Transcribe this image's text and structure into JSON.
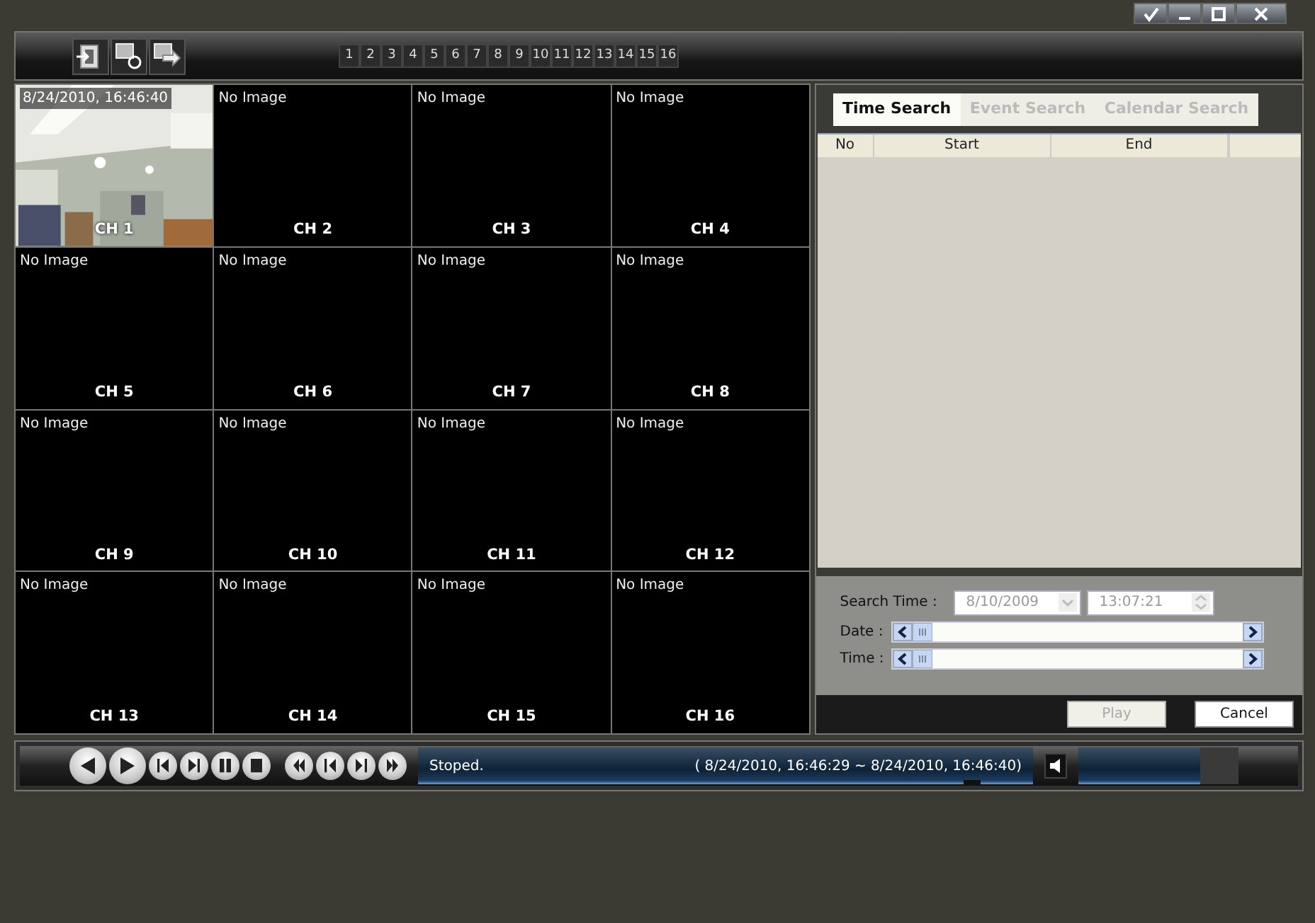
{
  "channel_buttons": [
    "1",
    "2",
    "3",
    "4",
    "5",
    "6",
    "7",
    "8",
    "9",
    "10",
    "11",
    "12",
    "13",
    "14",
    "15",
    "16"
  ],
  "channels": [
    {
      "kind": "picture",
      "timestamp": "8/24/2010, 16:46:40",
      "label": "CH 1"
    },
    {
      "kind": "empty",
      "status": "No Image",
      "label": "CH 2"
    },
    {
      "kind": "empty",
      "status": "No Image",
      "label": "CH 3"
    },
    {
      "kind": "empty",
      "status": "No Image",
      "label": "CH 4"
    },
    {
      "kind": "empty",
      "status": "No Image",
      "label": "CH 5"
    },
    {
      "kind": "empty",
      "status": "No Image",
      "label": "CH 6"
    },
    {
      "kind": "empty",
      "status": "No Image",
      "label": "CH 7"
    },
    {
      "kind": "empty",
      "status": "No Image",
      "label": "CH 8"
    },
    {
      "kind": "empty",
      "status": "No Image",
      "label": "CH 9"
    },
    {
      "kind": "empty",
      "status": "No Image",
      "label": "CH 10"
    },
    {
      "kind": "empty",
      "status": "No Image",
      "label": "CH 11"
    },
    {
      "kind": "empty",
      "status": "No Image",
      "label": "CH 12"
    },
    {
      "kind": "empty",
      "status": "No Image",
      "label": "CH 13"
    },
    {
      "kind": "empty",
      "status": "No Image",
      "label": "CH 14"
    },
    {
      "kind": "empty",
      "status": "No Image",
      "label": "CH 15"
    },
    {
      "kind": "empty",
      "status": "No Image",
      "label": "CH 16"
    }
  ],
  "search_tabs": [
    {
      "label": "Time Search",
      "selected": true
    },
    {
      "label": "Event Search",
      "selected": false
    },
    {
      "label": "Calendar Search",
      "selected": false
    }
  ],
  "table": {
    "columns": [
      "No",
      "Start",
      "End"
    ]
  },
  "search_form": {
    "search_time_label": "Search Time :",
    "date_value": "8/10/2009",
    "time_value": "13:07:21",
    "disabled": true,
    "date_label": "Date :",
    "time_label": "Time :"
  },
  "buttons": [
    {
      "label": "Play",
      "disabled": true
    },
    {
      "label": "Cancel",
      "disabled": false
    }
  ],
  "playback": {
    "status": "Stoped.",
    "range": "( 8/24/2010, 16:46:29 ~  8/24/2010, 16:46:40)",
    "progress": {
      "level": 0.9
    },
    "volume": {
      "level": 0.76
    }
  }
}
